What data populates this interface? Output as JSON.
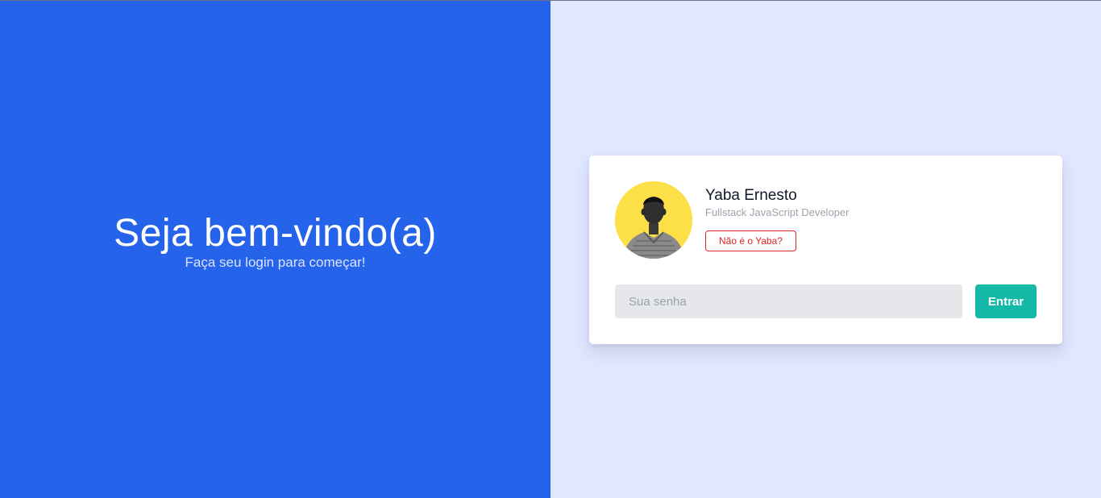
{
  "welcome": {
    "title": "Seja bem-vindo(a)",
    "subtitle": "Faça seu login para começar!"
  },
  "profile": {
    "name": "Yaba Ernesto",
    "role": "Fullstack JavaScript Developer",
    "switch_user_label": "Não é o Yaba?",
    "avatar_icon": "user-photo-avatar"
  },
  "login": {
    "password_placeholder": "Sua senha",
    "password_value": "",
    "submit_label": "Entrar"
  },
  "colors": {
    "left_background": "#2563eb",
    "right_background": "#e0e7ff",
    "accent_button": "#14b8a6",
    "danger": "#dc2626",
    "avatar_background": "#fde047"
  }
}
